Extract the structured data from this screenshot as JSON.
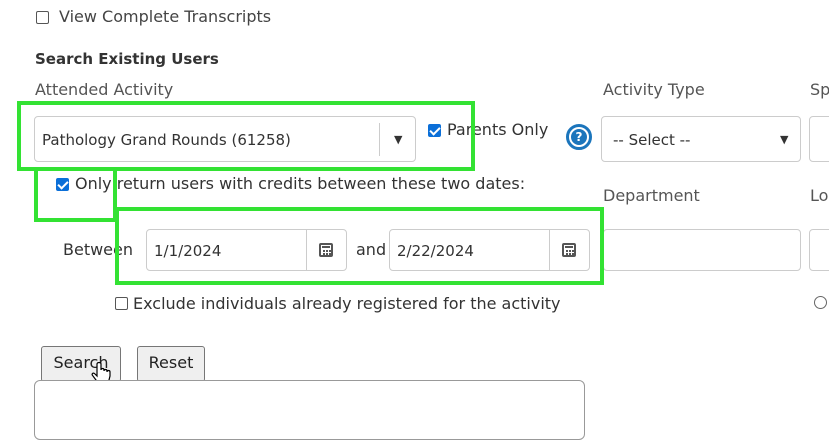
{
  "transcripts": {
    "label": "View Complete Transcripts"
  },
  "section": {
    "title": "Search Existing Users"
  },
  "attended_activity": {
    "label": "Attended Activity",
    "selected": "Pathology Grand Rounds (61258)"
  },
  "parents_only": {
    "label": "Parents Only",
    "checked": true
  },
  "activity_type": {
    "label": "Activity Type",
    "selected": "-- Select --"
  },
  "sp_column": {
    "label": "Sp"
  },
  "credits_filter": {
    "label": "Only return users with credits between these two dates:",
    "checked": true
  },
  "department": {
    "label": "Department"
  },
  "lo_column": {
    "label": "Lo"
  },
  "date_range": {
    "between_label": "Between",
    "start": "1/1/2024",
    "and_label": "and",
    "end": "2/22/2024"
  },
  "exclude": {
    "label": "Exclude individuals already registered for the activity",
    "checked": false
  },
  "buttons": {
    "search": "Search",
    "reset": "Reset"
  },
  "colors": {
    "highlight": "#33e233",
    "help_icon": "#1b75bc",
    "checkbox": "#0b6fd8"
  }
}
